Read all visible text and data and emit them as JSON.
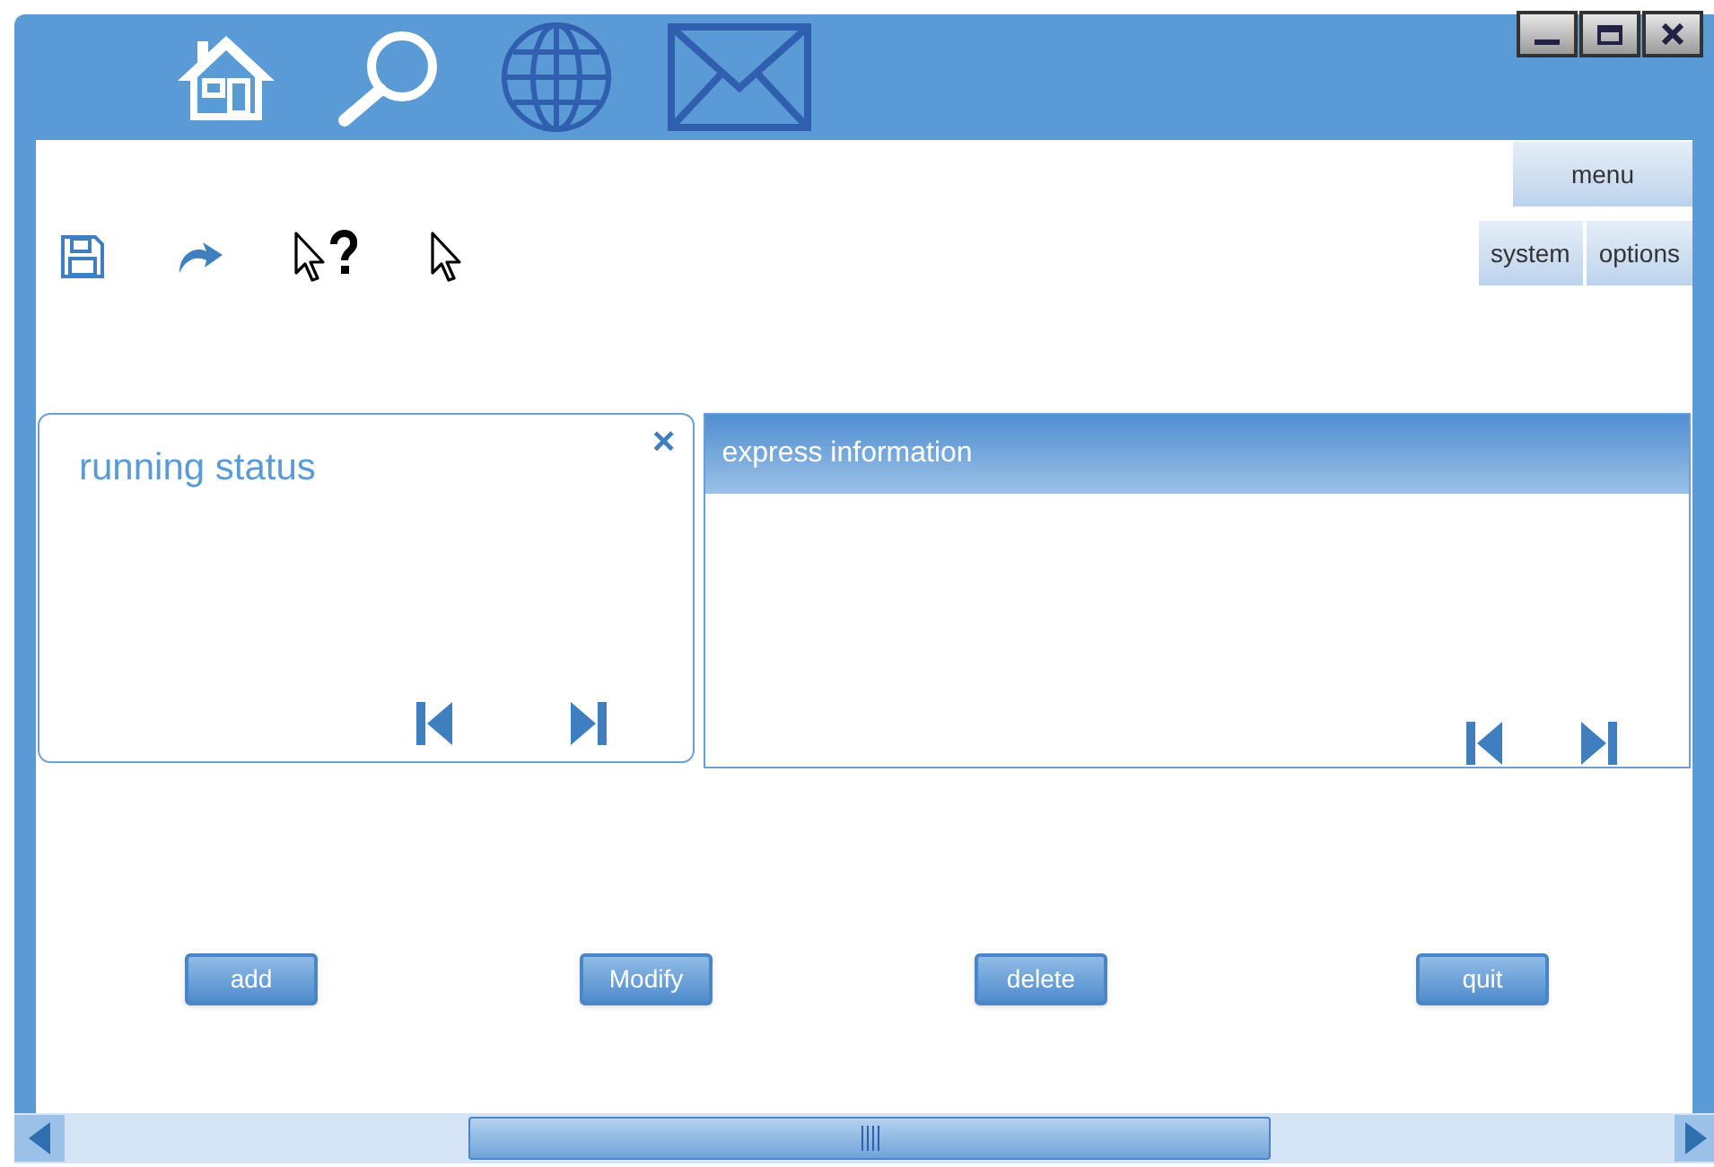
{
  "header_menu": {
    "label": "menu"
  },
  "header_buttons": [
    {
      "label": "system"
    },
    {
      "label": "options"
    }
  ],
  "running_status": {
    "title": "running status",
    "close": "×"
  },
  "express_information": {
    "title": "express information"
  },
  "buttons": [
    {
      "label": "add"
    },
    {
      "label": "Modify"
    },
    {
      "label": "delete"
    },
    {
      "label": "quit"
    }
  ]
}
